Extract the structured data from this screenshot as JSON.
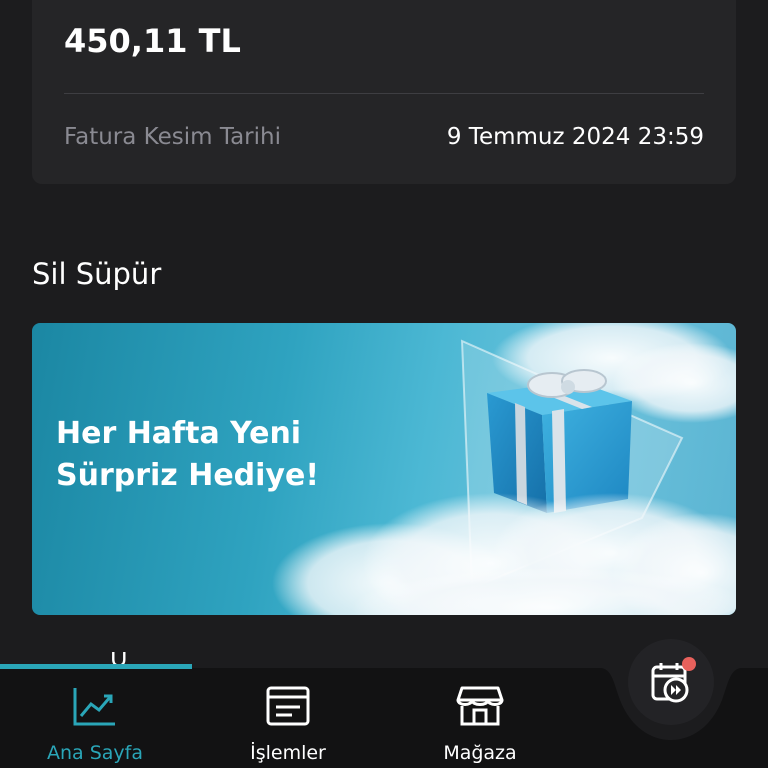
{
  "bill": {
    "amount": "450,11 TL",
    "due_label": "Fatura Kesim Tarihi",
    "due_value": "9 Temmuz 2024 23:59"
  },
  "section": {
    "title": "Sil Süpür",
    "next_title_peek": "Ü"
  },
  "banner": {
    "line1": "Her Hafta Yeni",
    "line2": "Sürpriz Hediye!"
  },
  "nav": {
    "items": [
      {
        "label": "Ana Sayfa",
        "icon": "chart-trend-icon",
        "active": true
      },
      {
        "label": "İşlemler",
        "icon": "transactions-icon",
        "active": false
      },
      {
        "label": "Mağaza",
        "icon": "store-icon",
        "active": false
      }
    ],
    "fab_icon": "calendar-play-icon",
    "notification": true
  },
  "colors": {
    "background": "#1c1c1e",
    "card": "#252527",
    "accent": "#2aa6b8",
    "notification": "#e8615c"
  }
}
